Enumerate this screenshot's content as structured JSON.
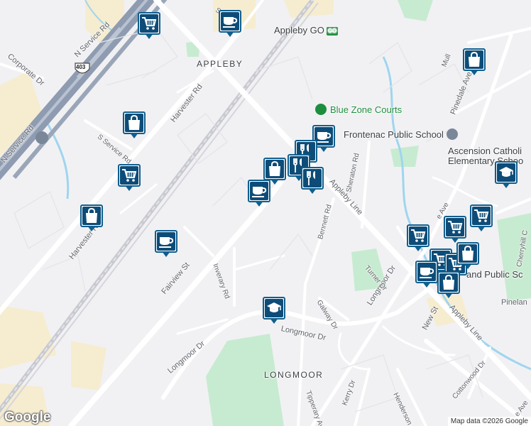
{
  "map": {
    "areas": {
      "appleby": "APPLEBY",
      "longmoor": "LONGMOOR"
    },
    "roads": {
      "n_service_rd_top": "N Service Rd",
      "corporate_dr": "Corporate Dr",
      "n_service_rd_left": "N Service Rd",
      "s_service_rd": "S Service Rd",
      "harvester_rd_top": "Harvester Rd",
      "harvester_rd_bottom": "Harvester Rd",
      "fairview_st": "Fairview St",
      "inverary_rd": "Inverary Rd",
      "longmoor_dr_left": "Longmoor Dr",
      "longmoor_dr_mid": "Longmoor Dr",
      "longmoor_dr_right": "Longmoor Dr",
      "bennett_rd": "Bennett Rd",
      "sheraton_rd": "Sheraton Rd",
      "turner_dr": "Turner Dr",
      "galway_dr": "Galway Dr",
      "tipperary_ave": "Tipperary Ave",
      "kerry_dr": "Kerry Dr",
      "henderson_rd": "Henderson Rd",
      "cottonwood_dr": "Cottonwood Dr",
      "new_st": "New St",
      "appleby_line_upper": "Appleby Line",
      "appleby_line_lower": "Appleby Line",
      "pinedale_ave": "Pinedale Ave",
      "mull_ave": "Mull",
      "cherryhill_cres": "Cherryhill C",
      "pinelands": "Pinelan",
      "ave_partial": "e Ave",
      "service_top": "Servic",
      "bottom_right_ave": "e Ave"
    },
    "highway_shield": "403",
    "pois": {
      "appleby_go": "Appleby GO",
      "go_badge": "GO",
      "blue_zone_courts": "Blue Zone Courts",
      "frontenac_public_school": "Frontenac Public School",
      "ascension_line1": "Ascension Catholi",
      "ascension_line2": "Elementary Schoo",
      "public_school_partial": "and Public Sc"
    },
    "colors": {
      "road": "#ffffff",
      "highway": "#8e9bb0",
      "park": "#c7ebd0",
      "water": "#9fd5ee",
      "marker_border": "#0f5f8e",
      "marker_fill": "#0d4c78",
      "commercial": "#f6ecd0"
    },
    "markers": [
      {
        "type": "shopping-cart"
      },
      {
        "type": "coffee-cup"
      },
      {
        "type": "shopping-bag"
      },
      {
        "type": "shopping-bag"
      },
      {
        "type": "shopping-cart"
      },
      {
        "type": "shopping-bag"
      },
      {
        "type": "coffee-cup"
      },
      {
        "type": "coffee-cup"
      },
      {
        "type": "coffee-cup"
      },
      {
        "type": "restaurant"
      },
      {
        "type": "restaurant"
      },
      {
        "type": "shopping-bag"
      },
      {
        "type": "restaurant"
      },
      {
        "type": "school"
      },
      {
        "type": "school"
      },
      {
        "type": "shopping-cart"
      },
      {
        "type": "shopping-cart"
      },
      {
        "type": "shopping-cart"
      },
      {
        "type": "shopping-cart"
      },
      {
        "type": "shopping-cart"
      },
      {
        "type": "coffee-cup"
      },
      {
        "type": "shopping-bag"
      },
      {
        "type": "shopping-bag"
      }
    ],
    "attribution": "Map data ©2026 Google",
    "logo": "Google"
  }
}
